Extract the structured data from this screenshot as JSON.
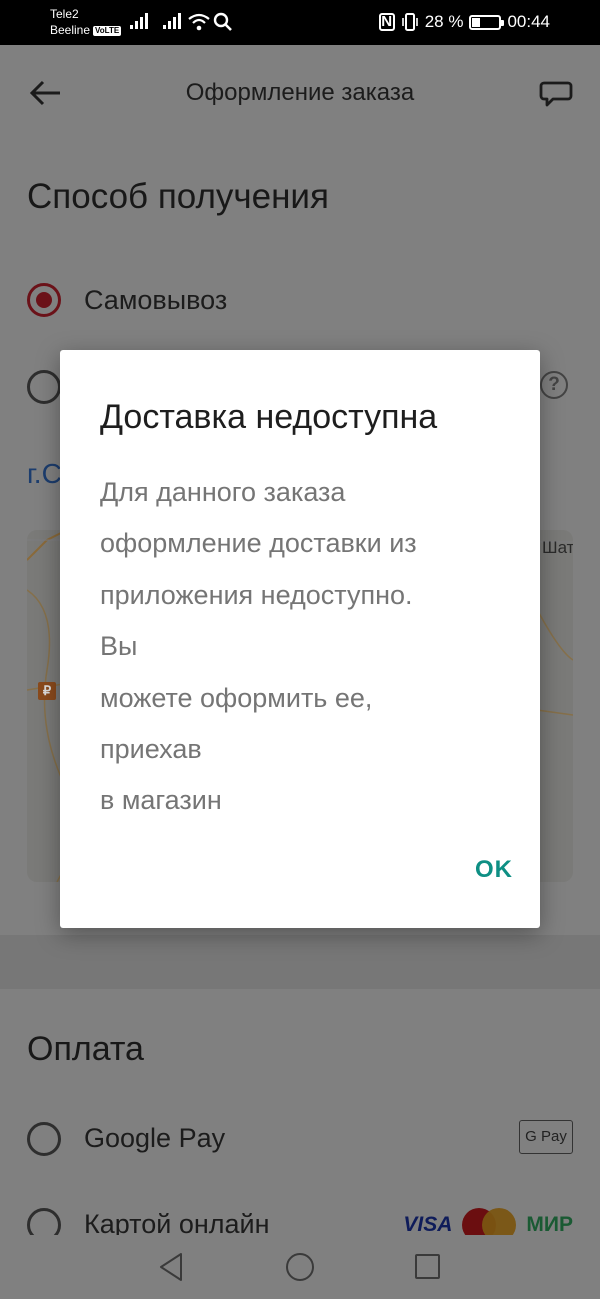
{
  "status_bar": {
    "carrier1": "Tele2",
    "carrier2": "Beeline",
    "volte": "VoLTE",
    "nfc": "N",
    "battery_percent": "28 %",
    "time": "00:44"
  },
  "header": {
    "title": "Оформление заказа"
  },
  "receive_method": {
    "title": "Способ получения",
    "options": [
      {
        "label": "Самовывоз",
        "selected": true
      },
      {
        "label": "",
        "selected": false
      }
    ],
    "help_icon": "?",
    "city_partial": "г.С",
    "map_label_partial": "Шат",
    "map_pin": "₽"
  },
  "payment": {
    "title": "Оплата",
    "options": [
      {
        "label": "Google Pay",
        "badge": "G Pay"
      },
      {
        "label": "Картой онлайн",
        "badges": [
          "VISA",
          "МИР"
        ]
      }
    ]
  },
  "dialog": {
    "title": "Доставка недоступна",
    "body_lines": [
      "Для данного заказа",
      "оформление доставки из",
      "приложения недоступно.",
      "Вы",
      "можете оформить ее,",
      "приехав",
      "в магазин"
    ],
    "ok_label": "OK"
  },
  "colors": {
    "accent": "#d4202e",
    "ok_button": "#0e8f84",
    "scrim": "#808080"
  }
}
